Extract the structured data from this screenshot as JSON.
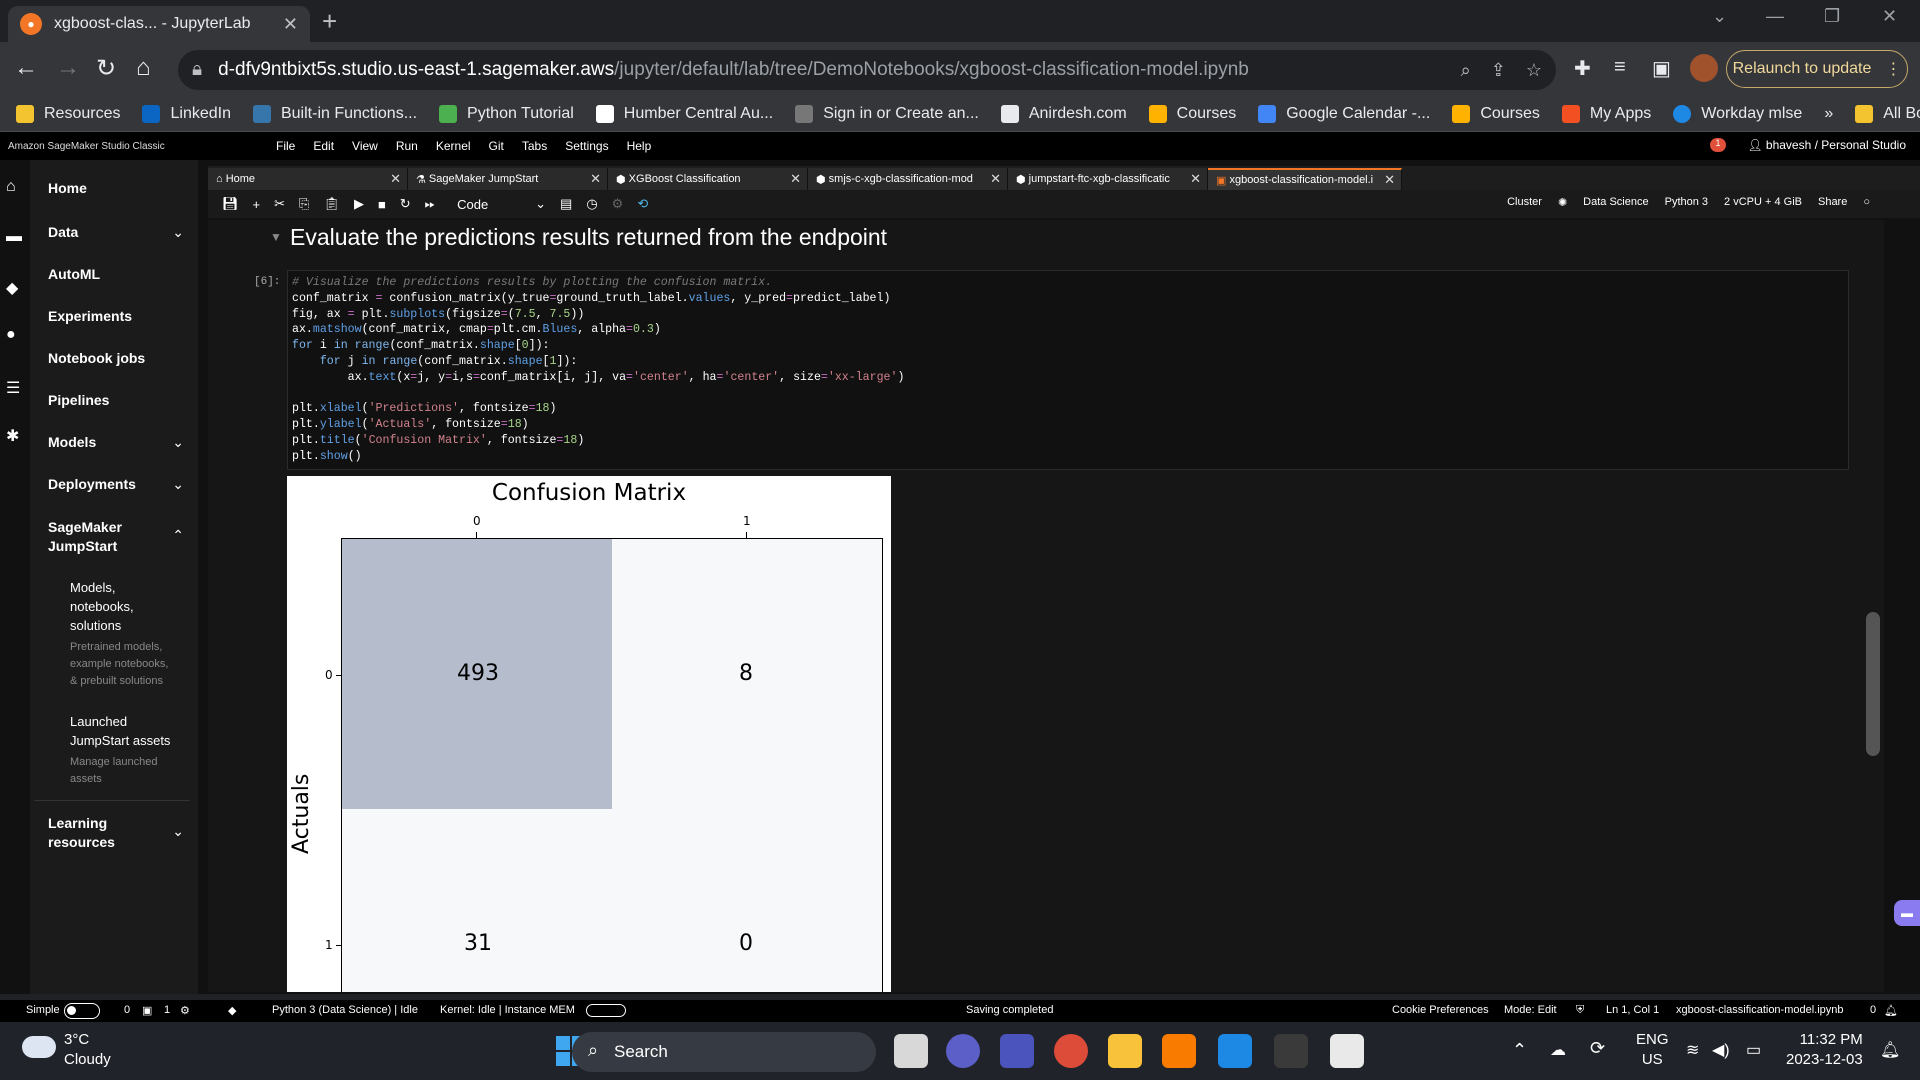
{
  "browser": {
    "tab_title": "xgboost-clas... - JupyterLab",
    "url_host": "d-dfv9ntbixt5s.studio.us-east-1.sagemaker.aws",
    "url_path": "/jupyter/default/lab/tree/DemoNotebooks/xgboost-classification-model.ipynb",
    "relaunch_label": "Relaunch to update",
    "bookmarks": [
      "Resources",
      "LinkedIn",
      "Built-in Functions...",
      "Python Tutorial",
      "Humber Central Au...",
      "Sign in or Create an...",
      "Anirdesh.com",
      "Courses",
      "Google Calendar -...",
      "Courses",
      "My Apps",
      "Workday mlse"
    ],
    "all_bookmarks": "All Bookmarks"
  },
  "studio": {
    "brand": "Amazon SageMaker Studio Classic",
    "menu": [
      "File",
      "Edit",
      "View",
      "Run",
      "Kernel",
      "Git",
      "Tabs",
      "Settings",
      "Help"
    ],
    "user": "bhavesh / Personal Studio",
    "notification_count": "1"
  },
  "sidebar": {
    "home": "Home",
    "data": "Data",
    "automl": "AutoML",
    "experiments": "Experiments",
    "notebook_jobs": "Notebook jobs",
    "pipelines": "Pipelines",
    "models": "Models",
    "deployments": "Deployments",
    "jumpstart_line1": "SageMaker",
    "jumpstart_line2": "JumpStart",
    "sub1_title_a": "Models,",
    "sub1_title_b": "notebooks,",
    "sub1_title_c": "solutions",
    "sub1_desc_a": "Pretrained models,",
    "sub1_desc_b": "example notebooks,",
    "sub1_desc_c": "& prebuilt solutions",
    "sub2_title_a": "Launched",
    "sub2_title_b": "JumpStart assets",
    "sub2_desc_a": "Manage launched",
    "sub2_desc_b": "assets",
    "learning_a": "Learning",
    "learning_b": "resources"
  },
  "doc_tabs": [
    "Home",
    "SageMaker JumpStart",
    "XGBoost Classification",
    "smjs-c-xgb-classification-mod",
    "jumpstart-ftc-xgb-classificatic",
    "xgboost-classification-model.i"
  ],
  "toolbar": {
    "cell_type": "Code",
    "cluster": "Cluster",
    "image": "Data Science",
    "kernel": "Python 3",
    "instance": "2 vCPU + 4 GiB",
    "share": "Share"
  },
  "notebook": {
    "heading": "Evaluate the predictions results returned from the endpoint",
    "prompt": "[6]:",
    "code_lines": [
      "# Visualize the predictions results by plotting the confusion matrix.",
      "conf_matrix = confusion_matrix(y_true=ground_truth_label.values, y_pred=predict_label)",
      "fig, ax = plt.subplots(figsize=(7.5, 7.5))",
      "ax.matshow(conf_matrix, cmap=plt.cm.Blues, alpha=0.3)",
      "for i in range(conf_matrix.shape[0]):",
      "    for j in range(conf_matrix.shape[1]):",
      "        ax.text(x=j, y=i,s=conf_matrix[i, j], va='center', ha='center', size='xx-large')",
      "",
      "plt.xlabel('Predictions', fontsize=18)",
      "plt.ylabel('Actuals', fontsize=18)",
      "plt.title('Confusion Matrix', fontsize=18)",
      "plt.show()"
    ]
  },
  "chart_data": {
    "type": "heatmap",
    "title": "Confusion Matrix",
    "xlabel": "",
    "ylabel": "Actuals",
    "x_ticks": [
      "0",
      "1"
    ],
    "y_ticks": [
      "0",
      "1"
    ],
    "matrix": [
      [
        493,
        8
      ],
      [
        31,
        0
      ]
    ],
    "colormap": "Blues",
    "alpha": 0.3
  },
  "statusbar": {
    "mode_label": "Simple",
    "count_a": "0",
    "count_b": "1",
    "kernel_name": "Python 3 (Data Science) | Idle",
    "kernel_status": "Kernel: Idle | Instance MEM",
    "saving": "Saving completed",
    "cookie": "Cookie Preferences",
    "mode": "Mode: Edit",
    "position": "Ln 1, Col 1",
    "filename": "xgboost-classification-model.ipynb",
    "notif": "0"
  },
  "taskbar": {
    "temp": "3°C",
    "weather": "Cloudy",
    "search": "Search",
    "lang_a": "ENG",
    "lang_b": "US",
    "time": "11:32 PM",
    "date": "2023-12-03"
  },
  "colors": {
    "accent": "#f37626",
    "cell_dark": "#b5bdcc",
    "cell_light": "#f7f8fa"
  }
}
